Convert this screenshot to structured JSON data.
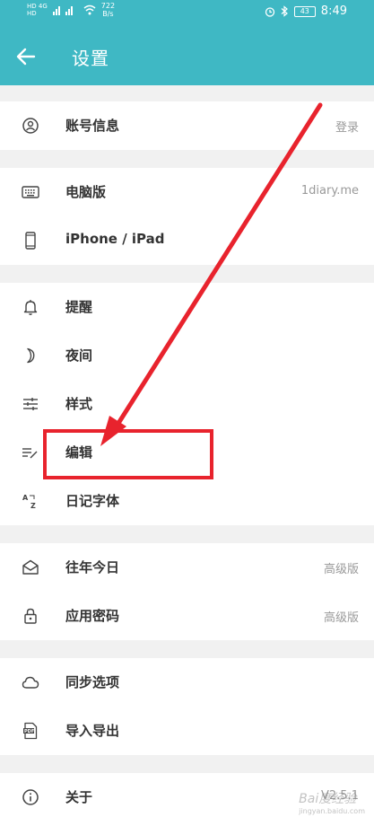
{
  "status": {
    "left_mini_top": "HD 4G",
    "left_mini_bottom": "HD",
    "speed_value": "722",
    "speed_unit": "B/s",
    "battery": "43",
    "time": "8:49"
  },
  "header": {
    "title": "设置"
  },
  "sections": {
    "account": {
      "label": "账号信息",
      "value": "登录"
    },
    "desktop": {
      "label": "电脑版",
      "value": "1diary.me"
    },
    "mobile": {
      "label": "iPhone / iPad"
    },
    "reminder": {
      "label": "提醒"
    },
    "night": {
      "label": "夜间"
    },
    "style": {
      "label": "样式"
    },
    "edit": {
      "label": "编辑"
    },
    "font": {
      "label": "日记字体"
    },
    "history": {
      "label": "往年今日",
      "value": "高级版"
    },
    "password": {
      "label": "应用密码",
      "value": "高级版"
    },
    "sync": {
      "label": "同步选项"
    },
    "import": {
      "label": "导入导出"
    },
    "about": {
      "label": "关于",
      "value": "V2.5.1"
    }
  },
  "watermark": {
    "main": "Bai度经验",
    "sub": "jingyan.baidu.com"
  },
  "colors": {
    "header": "#3fb8c4",
    "annotation": "#e8232d",
    "label": "#333333",
    "value": "#999999"
  }
}
